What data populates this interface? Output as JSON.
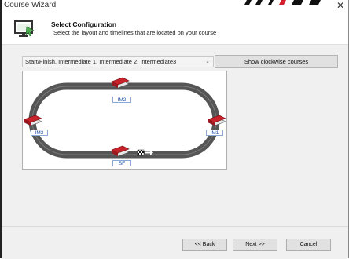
{
  "window": {
    "title": "Course Wizard",
    "close_label": "✕"
  },
  "header": {
    "title": "Select Configuration",
    "subtitle": "Select the layout and timelines that are located on your course",
    "icon": "course-wizard-icon"
  },
  "configuration": {
    "selected": "Start/Finish, Intermediate 1, Intermediate 2, Intermediate3",
    "dropdown_icon": "chevron-down-icon",
    "clockwise_button": "Show clockwise courses"
  },
  "course": {
    "timelines": [
      {
        "label": "IM2"
      },
      {
        "label": "IM3"
      },
      {
        "label": "IM1"
      },
      {
        "label": "SF"
      }
    ],
    "track_color": "#555555",
    "transponder_color": "#c8222b",
    "label_color": "#1f4fa8"
  },
  "buttons": {
    "back": "<< Back",
    "next": "Next >>",
    "cancel": "Cancel"
  }
}
